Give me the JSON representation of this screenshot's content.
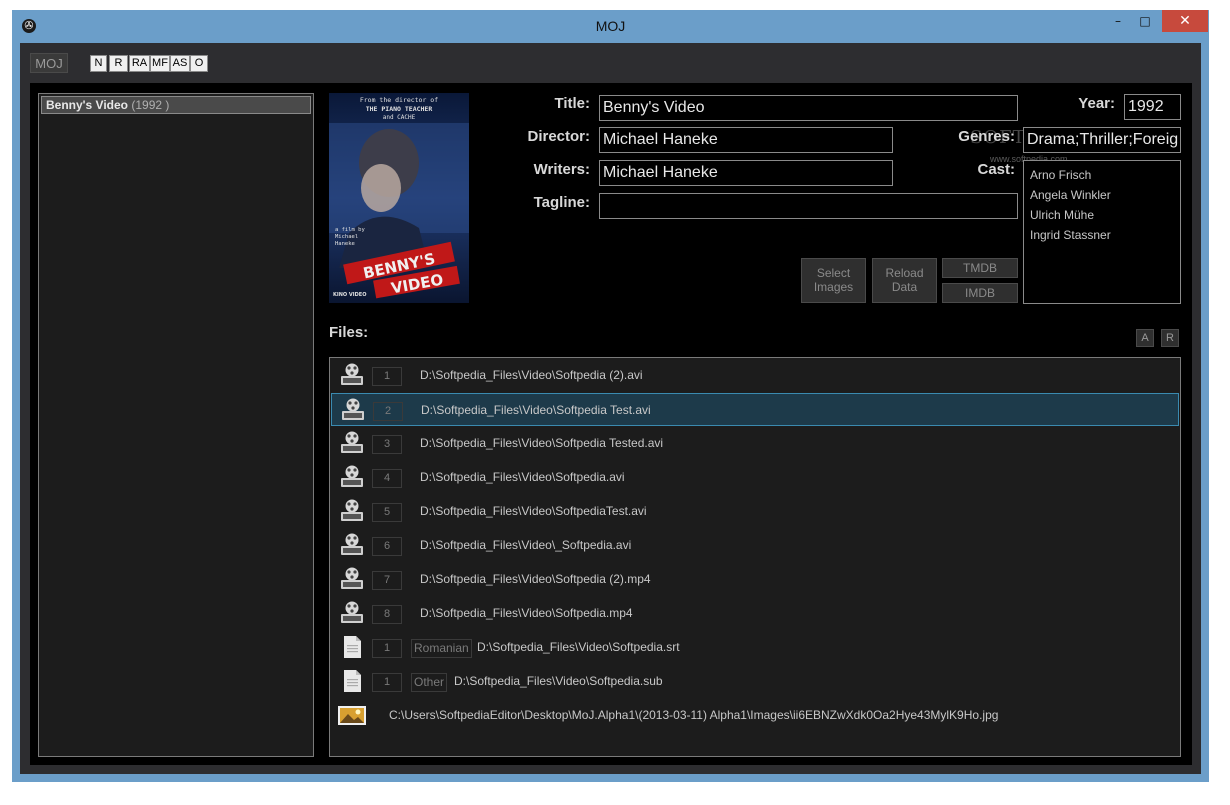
{
  "window": {
    "title": "MOJ",
    "minimize_glyph": "–",
    "maximize_glyph": "□",
    "close_glyph": "✕",
    "app_icon": "film-reel-icon"
  },
  "toolbar": {
    "moj_tab": "MOJ",
    "buttons": [
      "N",
      "R",
      "RA",
      "MF",
      "AS",
      "O"
    ]
  },
  "movie_list": [
    {
      "title": "Benny's Video",
      "year": "(1992 )"
    }
  ],
  "poster": {
    "top_line1": "From the director of",
    "top_line2": "THE PIANO TEACHER",
    "top_line3": "and CACHE",
    "credit1": "a film by",
    "credit2": "Michael",
    "credit3": "Haneke",
    "title1": "BENNY'S",
    "title2": "VIDEO",
    "studio": "KINO VIDEO"
  },
  "details": {
    "title_label": "Title:",
    "title": "Benny's Video",
    "director_label": "Director:",
    "director": "Michael Haneke",
    "writers_label": "Writers:",
    "writers": "Michael Haneke",
    "tagline_label": "Tagline:",
    "tagline": "",
    "year_label": "Year:",
    "year": "1992",
    "genres_label": "Genres:",
    "genres": "Drama;Thriller;Foreig",
    "cast_label": "Cast:",
    "cast": [
      "Arno Frisch",
      "Angela Winkler",
      "Ulrich Mühe",
      "Ingrid Stassner"
    ]
  },
  "actions": {
    "select_images_line1": "Select",
    "select_images_line2": "Images",
    "reload_data_line1": "Reload",
    "reload_data_line2": "Data",
    "tmdb": "TMDB",
    "imdb": "IMDB"
  },
  "watermark": {
    "text": "SOFTPEDIA",
    "url": "www.softpedia.com"
  },
  "files": {
    "label": "Files:",
    "add": "A",
    "remove": "R",
    "videos": [
      {
        "num": "1",
        "path": "D:\\Softpedia_Files\\Video\\Softpedia (2).avi"
      },
      {
        "num": "2",
        "path": "D:\\Softpedia_Files\\Video\\Softpedia Test.avi"
      },
      {
        "num": "3",
        "path": "D:\\Softpedia_Files\\Video\\Softpedia Tested.avi"
      },
      {
        "num": "4",
        "path": "D:\\Softpedia_Files\\Video\\Softpedia.avi"
      },
      {
        "num": "5",
        "path": "D:\\Softpedia_Files\\Video\\SoftpediaTest.avi"
      },
      {
        "num": "6",
        "path": "D:\\Softpedia_Files\\Video\\_Softpedia.avi"
      },
      {
        "num": "7",
        "path": "D:\\Softpedia_Files\\Video\\Softpedia (2).mp4"
      },
      {
        "num": "8",
        "path": "D:\\Softpedia_Files\\Video\\Softpedia.mp4"
      }
    ],
    "subtitles": [
      {
        "num": "1",
        "lang": "Romanian",
        "path": "D:\\Softpedia_Files\\Video\\Softpedia.srt"
      },
      {
        "num": "1",
        "lang": "Other",
        "path": "D:\\Softpedia_Files\\Video\\Softpedia.sub"
      }
    ],
    "image": {
      "path": "C:\\Users\\SoftpediaEditor\\Desktop\\MoJ.Alpha1\\(2013-03-11) Alpha1\\Images\\ii6EBNZwXdk0Oa2Hye43MylK9Ho.jpg"
    }
  },
  "colors": {
    "titlebar": "#6b9ec9",
    "close": "#c74a3d",
    "panel": "#1c1c1c",
    "selected_row": "#1d3a4a",
    "selected_border": "#3a8ab0"
  }
}
